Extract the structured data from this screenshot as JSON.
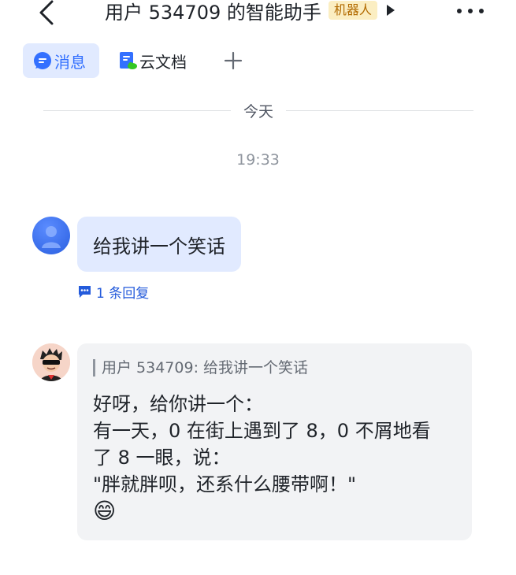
{
  "header": {
    "title": "用户 534709 的智能助手",
    "bot_tag": "机器人"
  },
  "tabs": [
    {
      "label": "消息",
      "icon": "chat-bubble-icon",
      "active": true
    },
    {
      "label": "云文档",
      "icon": "cloud-doc-icon",
      "active": false
    }
  ],
  "divider": {
    "label": "今天"
  },
  "timestamp": "19:33",
  "messages": {
    "user": {
      "text": "给我讲一个笑话",
      "reply_count_label": "1 条回复"
    },
    "bot": {
      "quote": "用户 534709: 给我讲一个笑话",
      "lines": [
        "好呀，给你讲一个：",
        "有一天，0 在街上遇到了 8，0 不屑地看",
        "了 8 一眼，说：",
        "\"胖就胖呗，还系什么腰带啊！\""
      ],
      "emoji": "😄"
    }
  },
  "colors": {
    "accent": "#3370ff",
    "user_bubble": "#e1eaff",
    "bot_bubble": "#f2f3f5",
    "tag_bg": "#fbeec2",
    "tag_text": "#b26a00"
  }
}
